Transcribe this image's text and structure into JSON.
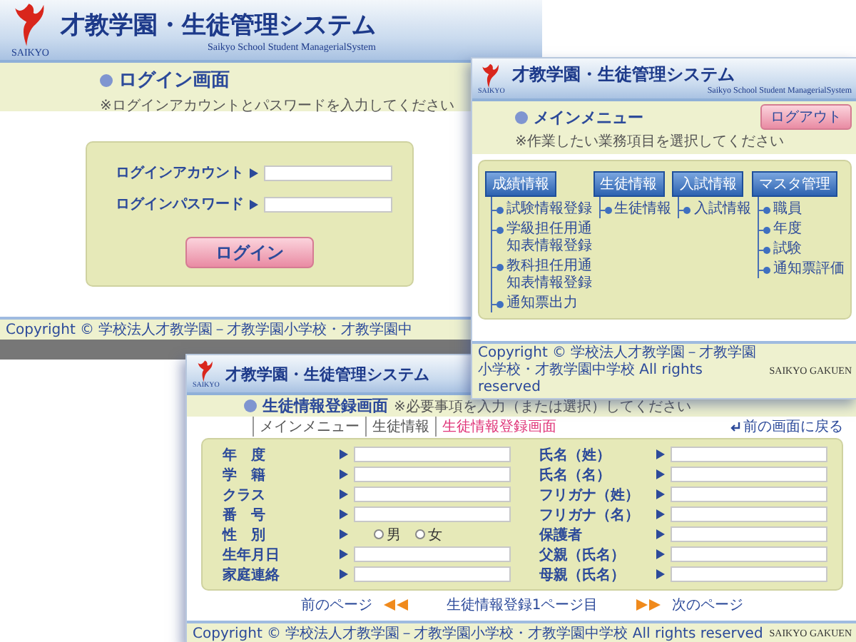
{
  "login_window": {
    "logo_text": "SAIKYO",
    "title": "才教学園・生徒管理システム",
    "subtitle": "Saikyo School Student ManagerialSystem",
    "page_title": "ログイン画面",
    "note": "※ログインアカウントとパスワードを入力してください",
    "fields": [
      {
        "label": "ログインアカウント"
      },
      {
        "label": "ログインパスワード"
      }
    ],
    "login_button": "ログイン",
    "copyright": "Copyright © 学校法人才教学園－才教学園小学校・才教学園中"
  },
  "menu_window": {
    "logo_text": "SAIKYO",
    "title": "才教学園・生徒管理システム",
    "subtitle": "Saikyo School Student ManagerialSystem",
    "page_title": "メインメニュー",
    "note": "※作業したい業務項目を選択してください",
    "logout_button": "ログアウト",
    "groups": [
      {
        "heading": "成績情報",
        "items": [
          "試験情報登録",
          "学級担任用通知表情報登録",
          "教科担任用通知表情報登録",
          "通知票出力"
        ]
      },
      {
        "heading": "生徒情報",
        "items": [
          "生徒情報"
        ]
      },
      {
        "heading": "入試情報",
        "items": [
          "入試情報"
        ]
      },
      {
        "heading": "マスタ管理",
        "items": [
          "職員",
          "年度",
          "試験",
          "通知票評価"
        ]
      }
    ],
    "copyright": "Copyright © 学校法人才教学園－才教学園小学校・才教学園中学校 All rights reserved",
    "brand": "SAIKYO GAKUEN"
  },
  "registration_window": {
    "logo_text": "SAIKYO",
    "title": "才教学園・生徒管理システム",
    "page_title": "生徒情報登録画面",
    "note": "※必要事項を入力（または選択）してください",
    "breadcrumb": [
      {
        "label": "メインメニュー",
        "current": false
      },
      {
        "label": "生徒情報",
        "current": false
      },
      {
        "label": "生徒情報登録画面",
        "current": true
      }
    ],
    "back_link": "前の画面に戻る",
    "left_fields": [
      {
        "label": "年　度",
        "kind": "text"
      },
      {
        "label": "学　籍",
        "kind": "text"
      },
      {
        "label": "クラス",
        "kind": "text"
      },
      {
        "label": "番　号",
        "kind": "text"
      },
      {
        "label": "性　別",
        "kind": "radio",
        "options": [
          {
            "label": "男",
            "selected": false
          },
          {
            "label": "女",
            "selected": false
          }
        ]
      },
      {
        "label": "生年月日",
        "kind": "text"
      },
      {
        "label": "家庭連絡",
        "kind": "text"
      }
    ],
    "right_fields": [
      {
        "label": "氏名（姓）",
        "kind": "text"
      },
      {
        "label": "氏名（名）",
        "kind": "text"
      },
      {
        "label": "フリガナ（姓）",
        "kind": "text"
      },
      {
        "label": "フリガナ（名）",
        "kind": "text"
      },
      {
        "label": "保護者",
        "kind": "text"
      },
      {
        "label": "父親（氏名）",
        "kind": "text"
      },
      {
        "label": "母親（氏名）",
        "kind": "text"
      }
    ],
    "prev_link": "前のページ",
    "page_label": "生徒情報登録1ページ目",
    "next_link": "次のページ",
    "copyright": "Copyright © 学校法人才教学園－才教学園小学校・才教学園中学校 All rights reserved",
    "brand": "SAIKYO GAKUEN"
  }
}
